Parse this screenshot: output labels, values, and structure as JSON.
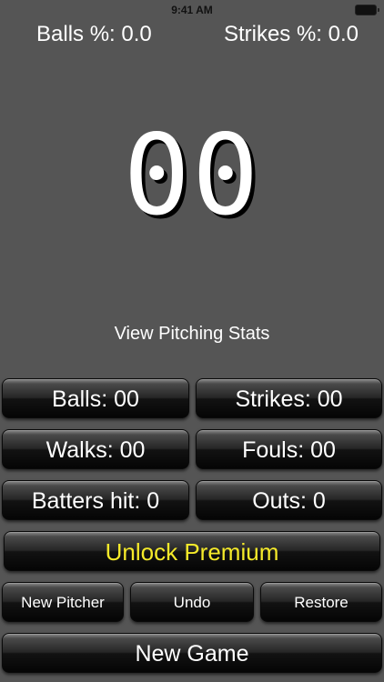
{
  "status_bar": {
    "time": "9:41 AM"
  },
  "stats": {
    "balls_pct": "Balls %: 0.0",
    "strikes_pct": "Strikes %: 0.0"
  },
  "pitch_count": "00",
  "view_stats_label": "View Pitching Stats",
  "counters": {
    "balls": "Balls: 00",
    "strikes": "Strikes: 00",
    "walks": "Walks: 00",
    "fouls": "Fouls: 00",
    "batters_hit": "Batters hit: 0",
    "outs": "Outs: 0"
  },
  "actions": {
    "unlock_premium": "Unlock Premium",
    "new_pitcher": "New Pitcher",
    "undo": "Undo",
    "restore": "Restore",
    "new_game": "New Game"
  },
  "colors": {
    "background": "#555555",
    "premium_text": "#f5ea2a",
    "button_dark": "#121212"
  }
}
